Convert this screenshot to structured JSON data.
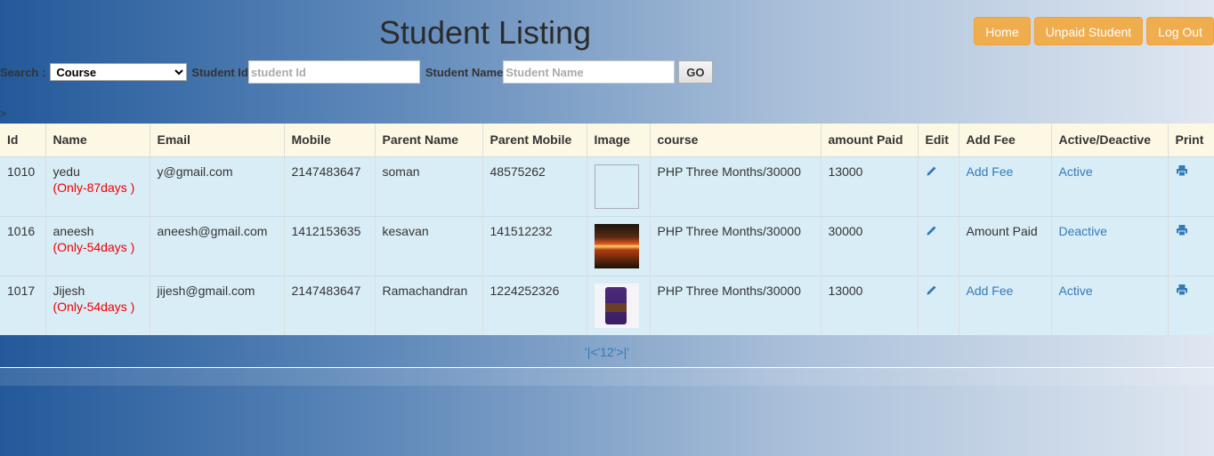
{
  "page": {
    "title": "Student Listing"
  },
  "nav": {
    "home": "Home",
    "unpaid": "Unpaid Student",
    "logout": "Log Out"
  },
  "search": {
    "label": "Search :",
    "select_value": "Course",
    "student_id_label": "Student Id",
    "student_id_placeholder": "student Id",
    "student_name_label": "Student Name",
    "student_name_placeholder": "Student Name",
    "go_label": "GO"
  },
  "stray_text": ">",
  "table": {
    "headers": [
      "Id",
      "Name",
      "Email",
      "Mobile",
      "Parent Name",
      "Parent Mobile",
      "Image",
      "course",
      "amount Paid",
      "Edit",
      "Add Fee",
      "Active/Deactive",
      "Print"
    ],
    "rows": [
      {
        "id": "1010",
        "name": "yedu",
        "days": "(Only-87days )",
        "email": "y@gmail.com",
        "mobile": "2147483647",
        "parent_name": "soman",
        "parent_mobile": "48575262",
        "image": "broken-image",
        "course": "PHP Three Months/30000",
        "amount_paid": "13000",
        "add_fee": "Add Fee",
        "add_fee_is_link": true,
        "status": "Active"
      },
      {
        "id": "1016",
        "name": "aneesh",
        "days": "(Only-54days )",
        "email": "aneesh@gmail.com",
        "mobile": "1412153635",
        "parent_name": "kesavan",
        "parent_mobile": "141512232",
        "image": "sunset-image",
        "course": "PHP Three Months/30000",
        "amount_paid": "30000",
        "add_fee": "Amount Paid",
        "add_fee_is_link": false,
        "status": "Deactive"
      },
      {
        "id": "1017",
        "name": "Jijesh",
        "days": "(Only-54days )",
        "email": "jijesh@gmail.com",
        "mobile": "2147483647",
        "parent_name": "Ramachandran",
        "parent_mobile": "1224252326",
        "image": "chocolate-image",
        "course": "PHP Three Months/30000",
        "amount_paid": "13000",
        "add_fee": "Add Fee",
        "add_fee_is_link": true,
        "status": "Active"
      }
    ]
  },
  "pagination": {
    "text": "'|<'12'>|'"
  },
  "colors": {
    "nav_button": "#f0ad4e",
    "header_row": "#fcf8e3",
    "body_row": "#d9edf7",
    "link": "#337ab7",
    "days_warning": "#ee0000"
  },
  "icons": {
    "edit": "pencil-icon",
    "print": "printer-icon"
  }
}
